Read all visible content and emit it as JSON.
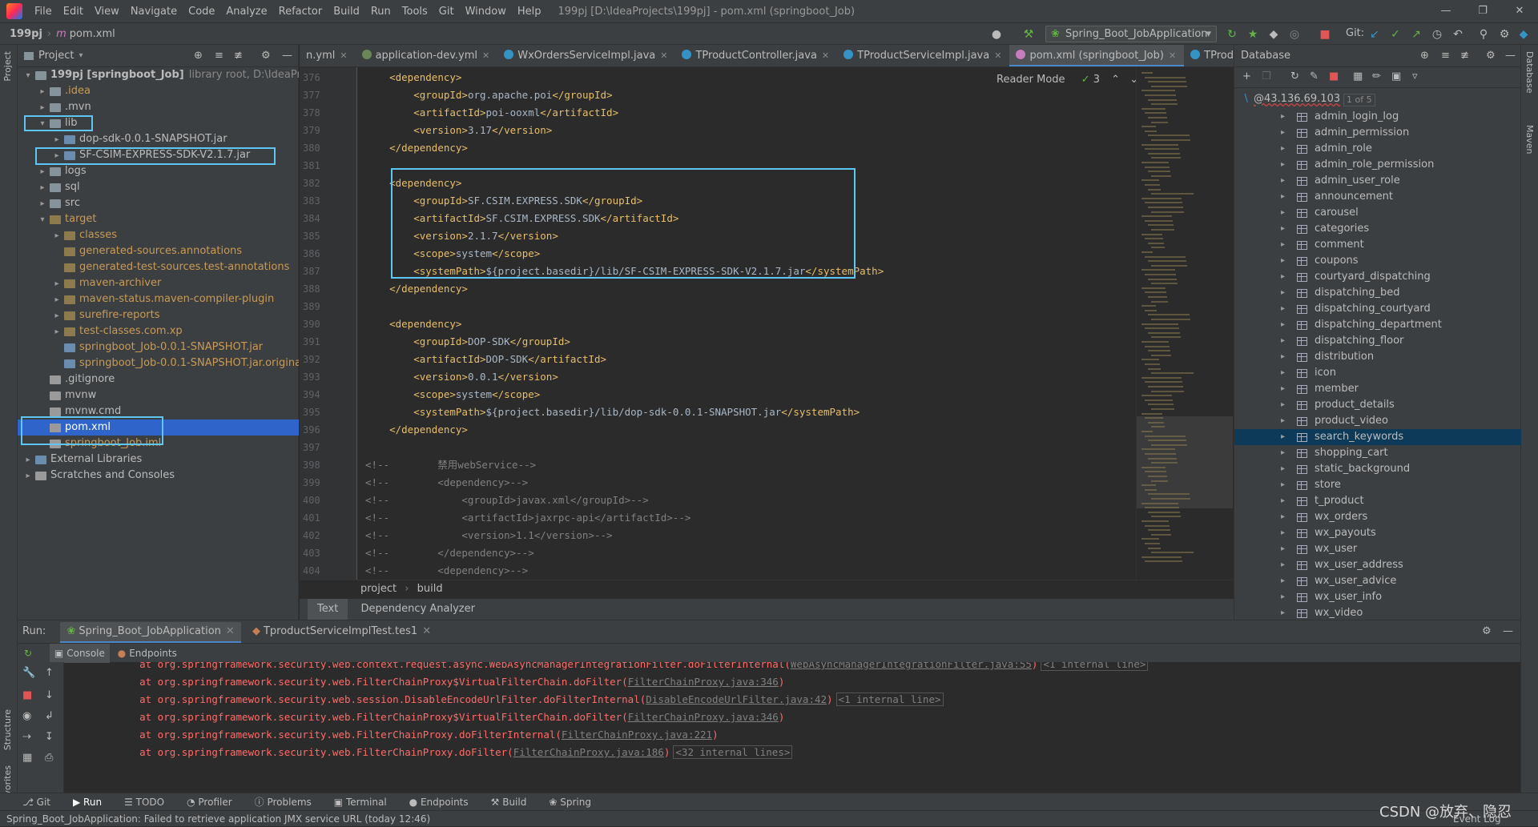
{
  "menu": [
    "File",
    "Edit",
    "View",
    "Navigate",
    "Code",
    "Analyze",
    "Refactor",
    "Build",
    "Run",
    "Tools",
    "Git",
    "Window",
    "Help"
  ],
  "window_title": "199pj [D:\\IdeaProjects\\199pj] - pom.xml (springboot_Job)",
  "breadcrumb": {
    "project": "199pj",
    "file": "pom.xml"
  },
  "run_config": "Spring_Boot_JobApplication",
  "git_label": "Git:",
  "project_panel": {
    "title": "Project",
    "tree": [
      {
        "indent": 0,
        "arrow": "v",
        "icon": "fold",
        "label": "199pj [springboot_Job]",
        "extra": "library root, D:\\IdeaProjects",
        "bold": true
      },
      {
        "indent": 1,
        "arrow": ">",
        "icon": "fold",
        "label": ".idea",
        "cls": "excluded"
      },
      {
        "indent": 1,
        "arrow": ">",
        "icon": "fold",
        "label": ".mvn"
      },
      {
        "indent": 1,
        "arrow": "v",
        "icon": "fold",
        "label": "lib"
      },
      {
        "indent": 2,
        "arrow": ">",
        "icon": "jar",
        "label": "dop-sdk-0.0.1-SNAPSHOT.jar"
      },
      {
        "indent": 2,
        "arrow": ">",
        "icon": "jar",
        "label": "SF-CSIM-EXPRESS-SDK-V2.1.7.jar"
      },
      {
        "indent": 1,
        "arrow": ">",
        "icon": "fold",
        "label": "logs"
      },
      {
        "indent": 1,
        "arrow": ">",
        "icon": "fold",
        "label": "sql"
      },
      {
        "indent": 1,
        "arrow": ">",
        "icon": "fold",
        "label": "src"
      },
      {
        "indent": 1,
        "arrow": "v",
        "icon": "foldex",
        "label": "target",
        "cls": "excluded"
      },
      {
        "indent": 2,
        "arrow": ">",
        "icon": "foldex",
        "label": "classes",
        "cls": "excluded"
      },
      {
        "indent": 2,
        "arrow": "",
        "icon": "foldex",
        "label": "generated-sources.annotations",
        "cls": "excluded"
      },
      {
        "indent": 2,
        "arrow": "",
        "icon": "foldex",
        "label": "generated-test-sources.test-annotations",
        "cls": "excluded"
      },
      {
        "indent": 2,
        "arrow": ">",
        "icon": "foldex",
        "label": "maven-archiver",
        "cls": "excluded"
      },
      {
        "indent": 2,
        "arrow": ">",
        "icon": "foldex",
        "label": "maven-status.maven-compiler-plugin",
        "cls": "excluded"
      },
      {
        "indent": 2,
        "arrow": ">",
        "icon": "foldex",
        "label": "surefire-reports",
        "cls": "excluded"
      },
      {
        "indent": 2,
        "arrow": ">",
        "icon": "foldex",
        "label": "test-classes.com.xp",
        "cls": "excluded"
      },
      {
        "indent": 2,
        "arrow": "",
        "icon": "jar",
        "label": "springboot_Job-0.0.1-SNAPSHOT.jar",
        "cls": "excluded"
      },
      {
        "indent": 2,
        "arrow": "",
        "icon": "jar",
        "label": "springboot_Job-0.0.1-SNAPSHOT.jar.original",
        "cls": "excluded"
      },
      {
        "indent": 1,
        "arrow": "",
        "icon": "file",
        "label": ".gitignore"
      },
      {
        "indent": 1,
        "arrow": "",
        "icon": "file",
        "label": "mvnw"
      },
      {
        "indent": 1,
        "arrow": "",
        "icon": "file",
        "label": "mvnw.cmd"
      },
      {
        "indent": 1,
        "arrow": "",
        "icon": "file",
        "label": "pom.xml",
        "selected": true
      },
      {
        "indent": 1,
        "arrow": "",
        "icon": "file",
        "label": "springboot_Job.iml",
        "cls": "excluded"
      },
      {
        "indent": 0,
        "arrow": ">",
        "icon": "jar",
        "label": "External Libraries"
      },
      {
        "indent": 0,
        "arrow": ">",
        "icon": "file",
        "label": "Scratches and Consoles"
      }
    ]
  },
  "editor": {
    "tabs": [
      {
        "label": "n.yml",
        "color": "#6a8759"
      },
      {
        "label": "application-dev.yml",
        "color": "#6a8759"
      },
      {
        "label": "WxOrdersServiceImpl.java",
        "color": "#3592c4"
      },
      {
        "label": "TProductController.java",
        "color": "#3592c4"
      },
      {
        "label": "TProductServiceImpl.java",
        "color": "#3592c4"
      },
      {
        "label": "pom.xml (springboot_Job)",
        "color": "#c77dbb",
        "active": true
      },
      {
        "label": "TProduct.java",
        "color": "#3592c4"
      }
    ],
    "reader_mode": "Reader Mode",
    "check_count": "3",
    "lines": [
      {
        "n": "376",
        "indent": "    ",
        "parts": [
          [
            "tg",
            "<dependency>"
          ]
        ]
      },
      {
        "n": "377",
        "indent": "        ",
        "parts": [
          [
            "tg",
            "<groupId>"
          ],
          [
            "tx",
            "org.apache.poi"
          ],
          [
            "tg",
            "</groupId>"
          ]
        ]
      },
      {
        "n": "378",
        "indent": "        ",
        "parts": [
          [
            "tg",
            "<artifactId>"
          ],
          [
            "tx",
            "poi-ooxml"
          ],
          [
            "tg",
            "</artifactId>"
          ]
        ]
      },
      {
        "n": "379",
        "indent": "        ",
        "parts": [
          [
            "tg",
            "<version>"
          ],
          [
            "tx",
            "3.17"
          ],
          [
            "tg",
            "</version>"
          ]
        ]
      },
      {
        "n": "380",
        "indent": "    ",
        "parts": [
          [
            "tg",
            "</dependency>"
          ]
        ]
      },
      {
        "n": "381",
        "indent": "",
        "parts": []
      },
      {
        "n": "382",
        "indent": "    ",
        "parts": [
          [
            "tg",
            "<dependency>"
          ]
        ]
      },
      {
        "n": "383",
        "indent": "        ",
        "parts": [
          [
            "tg",
            "<groupId>"
          ],
          [
            "tx",
            "SF.CSIM.EXPRESS.SDK"
          ],
          [
            "tg",
            "</groupId>"
          ]
        ]
      },
      {
        "n": "384",
        "indent": "        ",
        "parts": [
          [
            "tg",
            "<artifactId>"
          ],
          [
            "tx",
            "SF.CSIM.EXPRESS.SDK"
          ],
          [
            "tg",
            "</artifactId>"
          ]
        ]
      },
      {
        "n": "385",
        "indent": "        ",
        "parts": [
          [
            "tg",
            "<version>"
          ],
          [
            "tx",
            "2.1.7"
          ],
          [
            "tg",
            "</version>"
          ]
        ]
      },
      {
        "n": "386",
        "indent": "        ",
        "parts": [
          [
            "tg",
            "<scope>"
          ],
          [
            "tx",
            "system"
          ],
          [
            "tg",
            "</scope>"
          ]
        ]
      },
      {
        "n": "387",
        "indent": "        ",
        "parts": [
          [
            "tg",
            "<systemPath>"
          ],
          [
            "tx",
            "${project.basedir}/lib/SF-CSIM-EXPRESS-SDK-V2.1.7.jar"
          ],
          [
            "tg",
            "</systemPath>"
          ]
        ]
      },
      {
        "n": "388",
        "indent": "    ",
        "parts": [
          [
            "tg",
            "</dependency>"
          ]
        ]
      },
      {
        "n": "389",
        "indent": "",
        "parts": []
      },
      {
        "n": "390",
        "indent": "    ",
        "parts": [
          [
            "tg",
            "<dependency>"
          ]
        ]
      },
      {
        "n": "391",
        "indent": "        ",
        "parts": [
          [
            "tg",
            "<groupId>"
          ],
          [
            "tx",
            "DOP-SDK"
          ],
          [
            "tg",
            "</groupId>"
          ]
        ]
      },
      {
        "n": "392",
        "indent": "        ",
        "parts": [
          [
            "tg",
            "<artifactId>"
          ],
          [
            "tx",
            "DOP-SDK"
          ],
          [
            "tg",
            "</artifactId>"
          ]
        ]
      },
      {
        "n": "393",
        "indent": "        ",
        "parts": [
          [
            "tg",
            "<version>"
          ],
          [
            "tx",
            "0.0.1"
          ],
          [
            "tg",
            "</version>"
          ]
        ]
      },
      {
        "n": "394",
        "indent": "        ",
        "parts": [
          [
            "tg",
            "<scope>"
          ],
          [
            "tx",
            "system"
          ],
          [
            "tg",
            "</scope>"
          ]
        ]
      },
      {
        "n": "395",
        "indent": "        ",
        "parts": [
          [
            "tg",
            "<systemPath>"
          ],
          [
            "tx",
            "${project.basedir}/lib/dop-sdk-0.0.1-SNAPSHOT.jar"
          ],
          [
            "tg",
            "</systemPath>"
          ]
        ]
      },
      {
        "n": "396",
        "indent": "    ",
        "parts": [
          [
            "tg",
            "</dependency>"
          ]
        ]
      },
      {
        "n": "397",
        "indent": "",
        "parts": []
      },
      {
        "n": "398",
        "indent": "",
        "parts": [
          [
            "cm",
            "<!--        禁用webService-->"
          ]
        ]
      },
      {
        "n": "399",
        "indent": "",
        "parts": [
          [
            "cm",
            "<!--        <dependency>-->"
          ]
        ]
      },
      {
        "n": "400",
        "indent": "",
        "parts": [
          [
            "cm",
            "<!--            <groupId>javax.xml</groupId>-->"
          ]
        ]
      },
      {
        "n": "401",
        "indent": "",
        "parts": [
          [
            "cm",
            "<!--            <artifactId>jaxrpc-api</artifactId>-->"
          ]
        ]
      },
      {
        "n": "402",
        "indent": "",
        "parts": [
          [
            "cm",
            "<!--            <version>1.1</version>-->"
          ]
        ]
      },
      {
        "n": "403",
        "indent": "",
        "parts": [
          [
            "cm",
            "<!--        </dependency>-->"
          ]
        ]
      },
      {
        "n": "404",
        "indent": "",
        "parts": [
          [
            "cm",
            "<!--        <dependency>-->"
          ]
        ]
      }
    ],
    "breadcrumb": [
      "project",
      "build"
    ],
    "bottom_tabs": [
      "Text",
      "Dependency Analyzer"
    ]
  },
  "database": {
    "title": "Database",
    "host": "@43.136.69.103",
    "count": "1 of 5",
    "tables": [
      "admin_login_log",
      "admin_permission",
      "admin_role",
      "admin_role_permission",
      "admin_user_role",
      "announcement",
      "carousel",
      "categories",
      "comment",
      "coupons",
      "courtyard_dispatching",
      "dispatching_bed",
      "dispatching_courtyard",
      "dispatching_department",
      "dispatching_floor",
      "distribution",
      "icon",
      "member",
      "product_details",
      "product_video",
      "search_keywords",
      "shopping_cart",
      "static_background",
      "store",
      "t_product",
      "wx_orders",
      "wx_payouts",
      "wx_user",
      "wx_user_address",
      "wx_user_advice",
      "wx_user_info",
      "wx_video"
    ],
    "selected": "search_keywords"
  },
  "run_panel": {
    "label": "Run:",
    "tabs": [
      "Spring_Boot_JobApplication",
      "TproductServiceImplTest.tes1"
    ],
    "subtabs": [
      "Console",
      "Endpoints"
    ],
    "lines": [
      {
        "pre": "    at org.springframework.security.web.context.request.async.WebAsyncManagerIntegrationFilter.doFilterInternal(",
        "link": "WebAsyncManagerIntegrationFilter.java:55",
        "post": ")",
        "inl": "<1 internal line>"
      },
      {
        "pre": "    at org.springframework.security.web.FilterChainProxy$VirtualFilterChain.doFilter(",
        "link": "FilterChainProxy.java:346",
        "post": ")",
        "inl": ""
      },
      {
        "pre": "    at org.springframework.security.web.session.DisableEncodeUrlFilter.doFilterInternal(",
        "link": "DisableEncodeUrlFilter.java:42",
        "post": ")",
        "inl": "<1 internal line>"
      },
      {
        "pre": "    at org.springframework.security.web.FilterChainProxy$VirtualFilterChain.doFilter(",
        "link": "FilterChainProxy.java:346",
        "post": ")",
        "inl": ""
      },
      {
        "pre": "    at org.springframework.security.web.FilterChainProxy.doFilterInternal(",
        "link": "FilterChainProxy.java:221",
        "post": ")",
        "inl": ""
      },
      {
        "pre": "    at org.springframework.security.web.FilterChainProxy.doFilter(",
        "link": "FilterChainProxy.java:186",
        "post": ")",
        "inl": "<32 internal lines>"
      }
    ]
  },
  "tool_windows": [
    "Git",
    "Run",
    "TODO",
    "Profiler",
    "Problems",
    "Terminal",
    "Endpoints",
    "Build",
    "Spring"
  ],
  "event_log": "Event Log",
  "status_text": "Spring_Boot_JobApplication: Failed to retrieve application JMX service URL (today 12:46)",
  "watermark": "CSDN @放弃、隐忍",
  "left_strip": [
    "Project",
    "Structure",
    "Favorites"
  ],
  "right_strip": [
    "Database",
    "Maven"
  ]
}
